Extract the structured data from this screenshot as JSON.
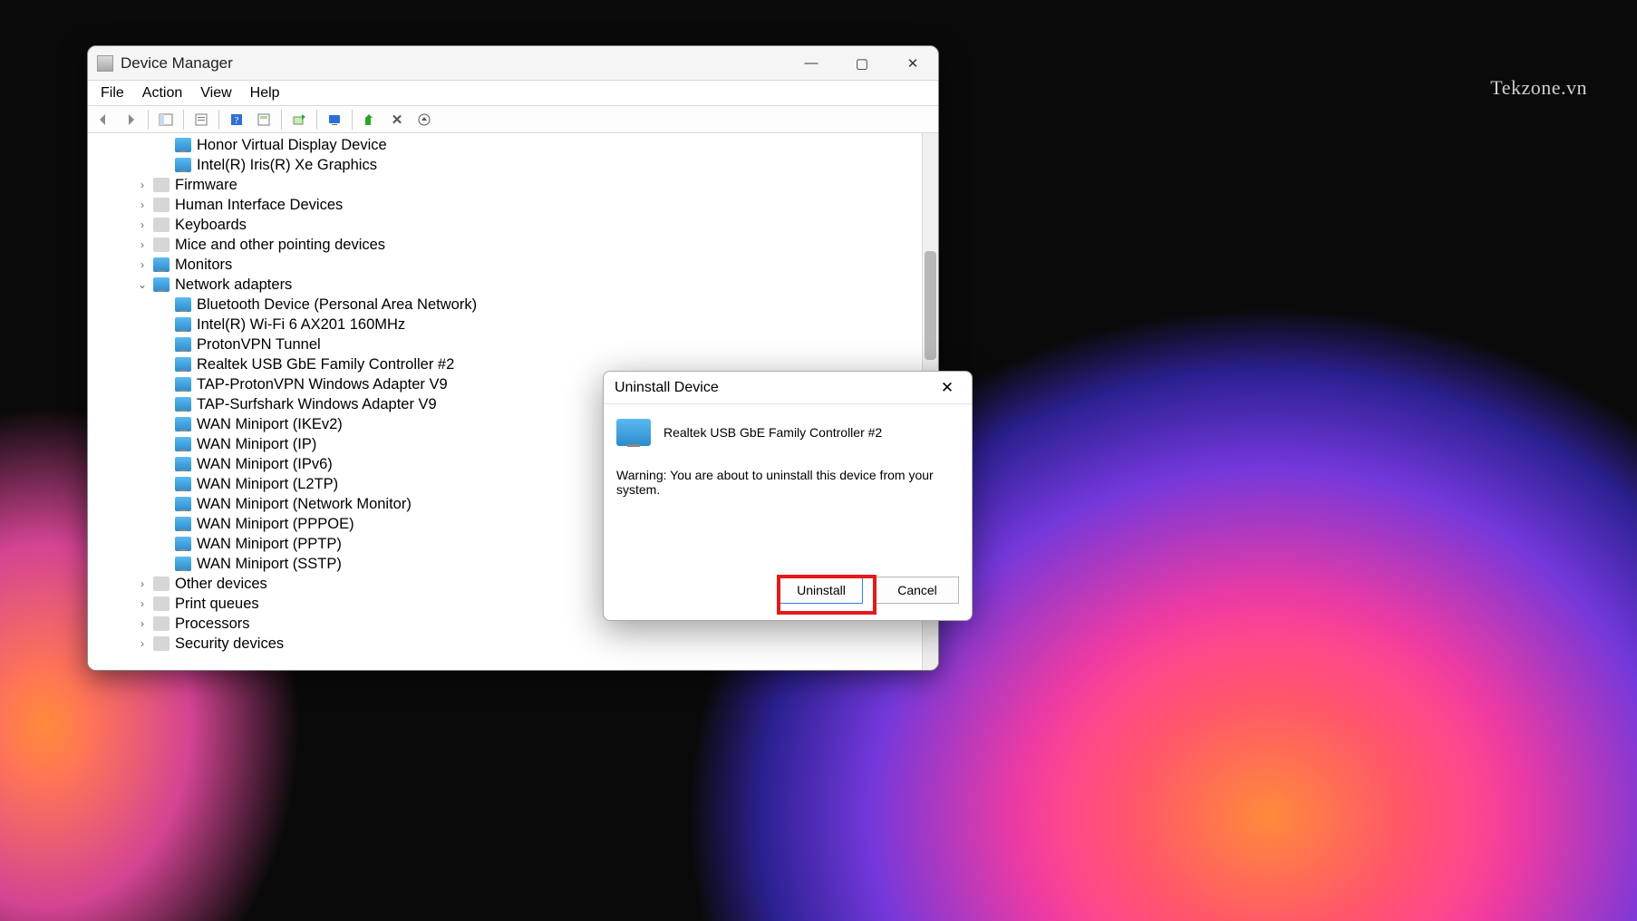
{
  "watermark": "Tekzone.vn",
  "window": {
    "title": "Device Manager",
    "menu": {
      "file": "File",
      "action": "Action",
      "view": "View",
      "help": "Help"
    }
  },
  "tree": {
    "items": [
      {
        "label": "Honor Virtual Display Device",
        "level": 3,
        "icon": "mon",
        "expand": ""
      },
      {
        "label": "Intel(R) Iris(R) Xe Graphics",
        "level": 3,
        "icon": "mon",
        "expand": ""
      },
      {
        "label": "Firmware",
        "level": 2,
        "icon": "cat",
        "expand": ">"
      },
      {
        "label": "Human Interface Devices",
        "level": 2,
        "icon": "cat",
        "expand": ">"
      },
      {
        "label": "Keyboards",
        "level": 2,
        "icon": "cat",
        "expand": ">"
      },
      {
        "label": "Mice and other pointing devices",
        "level": 2,
        "icon": "cat",
        "expand": ">"
      },
      {
        "label": "Monitors",
        "level": 2,
        "icon": "mon",
        "expand": ">"
      },
      {
        "label": "Network adapters",
        "level": 2,
        "icon": "mon",
        "expand": "v"
      },
      {
        "label": "Bluetooth Device (Personal Area Network)",
        "level": 3,
        "icon": "mon",
        "expand": ""
      },
      {
        "label": "Intel(R) Wi-Fi 6 AX201 160MHz",
        "level": 3,
        "icon": "mon",
        "expand": ""
      },
      {
        "label": "ProtonVPN Tunnel",
        "level": 3,
        "icon": "mon",
        "expand": ""
      },
      {
        "label": "Realtek USB GbE Family Controller #2",
        "level": 3,
        "icon": "mon",
        "expand": ""
      },
      {
        "label": "TAP-ProtonVPN Windows Adapter V9",
        "level": 3,
        "icon": "mon",
        "expand": ""
      },
      {
        "label": "TAP-Surfshark Windows Adapter V9",
        "level": 3,
        "icon": "mon",
        "expand": ""
      },
      {
        "label": "WAN Miniport (IKEv2)",
        "level": 3,
        "icon": "mon",
        "expand": ""
      },
      {
        "label": "WAN Miniport (IP)",
        "level": 3,
        "icon": "mon",
        "expand": ""
      },
      {
        "label": "WAN Miniport (IPv6)",
        "level": 3,
        "icon": "mon",
        "expand": ""
      },
      {
        "label": "WAN Miniport (L2TP)",
        "level": 3,
        "icon": "mon",
        "expand": ""
      },
      {
        "label": "WAN Miniport (Network Monitor)",
        "level": 3,
        "icon": "mon",
        "expand": ""
      },
      {
        "label": "WAN Miniport (PPPOE)",
        "level": 3,
        "icon": "mon",
        "expand": ""
      },
      {
        "label": "WAN Miniport (PPTP)",
        "level": 3,
        "icon": "mon",
        "expand": ""
      },
      {
        "label": "WAN Miniport (SSTP)",
        "level": 3,
        "icon": "mon",
        "expand": ""
      },
      {
        "label": "Other devices",
        "level": 2,
        "icon": "cat",
        "expand": ">"
      },
      {
        "label": "Print queues",
        "level": 2,
        "icon": "cat",
        "expand": ">"
      },
      {
        "label": "Processors",
        "level": 2,
        "icon": "cat",
        "expand": ">"
      },
      {
        "label": "Security devices",
        "level": 2,
        "icon": "cat",
        "expand": ">"
      }
    ]
  },
  "dialog": {
    "title": "Uninstall Device",
    "device": "Realtek USB GbE Family Controller #2",
    "warning": "Warning: You are about to uninstall this device from your system.",
    "uninstall": "Uninstall",
    "cancel": "Cancel"
  }
}
